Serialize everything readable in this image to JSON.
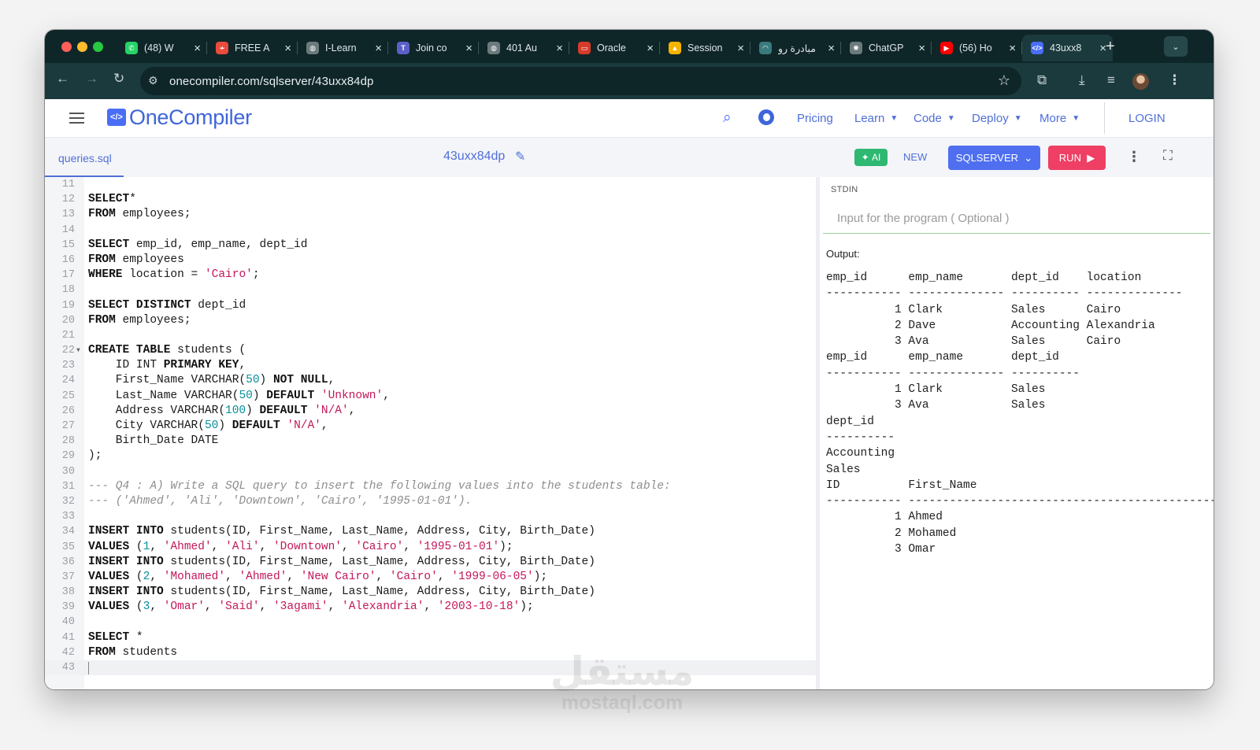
{
  "browser": {
    "tabs": [
      {
        "title": "(48) W",
        "icon": "whatsapp-icon",
        "color": "#25d366",
        "glyph": "✆"
      },
      {
        "title": "FREE A",
        "icon": "free-ai-icon",
        "color": "#e94b3c",
        "glyph": "≁"
      },
      {
        "title": "I-Learn",
        "icon": "globe-icon",
        "color": "#6b7b7d",
        "glyph": "◍"
      },
      {
        "title": "Join co",
        "icon": "teams-icon",
        "color": "#5b5fc7",
        "glyph": "T"
      },
      {
        "title": "401 Au",
        "icon": "globe-icon",
        "color": "#6b7b7d",
        "glyph": "◍"
      },
      {
        "title": "Oracle",
        "icon": "oracle-icon",
        "color": "#d63b2a",
        "glyph": "▭"
      },
      {
        "title": "Session",
        "icon": "google-drive-icon",
        "color": "#f4b400",
        "glyph": "▲"
      },
      {
        "title": "مبادرة رو",
        "icon": "initiative-icon",
        "color": "#3a7a7d",
        "glyph": "◠"
      },
      {
        "title": "ChatGP",
        "icon": "chatgpt-icon",
        "color": "#6b7b7d",
        "glyph": "✺"
      },
      {
        "title": "(56) Ho",
        "icon": "youtube-icon",
        "color": "#ff0000",
        "glyph": "▶"
      },
      {
        "title": "43uxx8",
        "icon": "onecompiler-icon",
        "color": "#4a6ef5",
        "glyph": "</>"
      }
    ],
    "url": "onecompiler.com/sqlserver/43uxx84dp"
  },
  "site": {
    "logo_mark": "</>",
    "logo_text": "OneCompiler",
    "nav": {
      "pricing": "Pricing",
      "learn": "Learn",
      "code": "Code",
      "deploy": "Deploy",
      "more": "More",
      "login": "LOGIN"
    }
  },
  "editor": {
    "file_tab": "queries.sql",
    "code_id": "43uxx84dp",
    "ai_label": "AI",
    "new_label": "NEW",
    "language": "SQLSERVER",
    "run_label": "RUN",
    "lines": [
      {
        "n": "11",
        "t": []
      },
      {
        "n": "12",
        "t": [
          [
            "kw",
            "SELECT"
          ],
          [
            "",
            "*"
          ]
        ]
      },
      {
        "n": "13",
        "t": [
          [
            "kw",
            "FROM"
          ],
          [
            "",
            " employees;"
          ]
        ]
      },
      {
        "n": "14",
        "t": []
      },
      {
        "n": "15",
        "t": [
          [
            "kw",
            "SELECT"
          ],
          [
            "",
            " emp_id, emp_name, dept_id"
          ]
        ]
      },
      {
        "n": "16",
        "t": [
          [
            "kw",
            "FROM"
          ],
          [
            "",
            " employees"
          ]
        ]
      },
      {
        "n": "17",
        "t": [
          [
            "kw",
            "WHERE"
          ],
          [
            "",
            " location = "
          ],
          [
            "str",
            "'Cairo'"
          ],
          [
            "",
            ";"
          ]
        ]
      },
      {
        "n": "18",
        "t": []
      },
      {
        "n": "19",
        "t": [
          [
            "kw",
            "SELECT DISTINCT"
          ],
          [
            "",
            " dept_id"
          ]
        ]
      },
      {
        "n": "20",
        "t": [
          [
            "kw",
            "FROM"
          ],
          [
            "",
            " employees;"
          ]
        ]
      },
      {
        "n": "21",
        "t": []
      },
      {
        "n": "22",
        "fold": true,
        "t": [
          [
            "kw",
            "CREATE TABLE"
          ],
          [
            "",
            " students ("
          ]
        ]
      },
      {
        "n": "23",
        "t": [
          [
            "",
            "    ID INT "
          ],
          [
            "kw",
            "PRIMARY KEY"
          ],
          [
            "",
            ","
          ]
        ]
      },
      {
        "n": "24",
        "t": [
          [
            "",
            "    First_Name VARCHAR("
          ],
          [
            "num",
            "50"
          ],
          [
            "",
            ") "
          ],
          [
            "kw",
            "NOT NULL"
          ],
          [
            "",
            ","
          ]
        ]
      },
      {
        "n": "25",
        "t": [
          [
            "",
            "    Last_Name VARCHAR("
          ],
          [
            "num",
            "50"
          ],
          [
            "",
            ") "
          ],
          [
            "kw",
            "DEFAULT"
          ],
          [
            "str",
            " 'Unknown'"
          ],
          [
            "",
            ","
          ]
        ]
      },
      {
        "n": "26",
        "t": [
          [
            "",
            "    Address VARCHAR("
          ],
          [
            "num",
            "100"
          ],
          [
            "",
            ") "
          ],
          [
            "kw",
            "DEFAULT"
          ],
          [
            "str",
            " 'N/A'"
          ],
          [
            "",
            ","
          ]
        ]
      },
      {
        "n": "27",
        "t": [
          [
            "",
            "    City VARCHAR("
          ],
          [
            "num",
            "50"
          ],
          [
            "",
            ") "
          ],
          [
            "kw",
            "DEFAULT"
          ],
          [
            "str",
            " 'N/A'"
          ],
          [
            "",
            ","
          ]
        ]
      },
      {
        "n": "28",
        "t": [
          [
            "",
            "    Birth_Date DATE"
          ]
        ]
      },
      {
        "n": "29",
        "t": [
          [
            "",
            ");"
          ]
        ]
      },
      {
        "n": "30",
        "t": []
      },
      {
        "n": "31",
        "t": [
          [
            "cmt",
            "--- Q4 : A) Write a SQL query to insert the following values into the students table:"
          ]
        ]
      },
      {
        "n": "32",
        "t": [
          [
            "cmt",
            "--- ('Ahmed', 'Ali', 'Downtown', 'Cairo', '1995-01-01')."
          ]
        ]
      },
      {
        "n": "33",
        "t": []
      },
      {
        "n": "34",
        "t": [
          [
            "kw",
            "INSERT INTO"
          ],
          [
            "",
            " students(ID, First_Name, Last_Name, Address, City, Birth_Date)"
          ]
        ]
      },
      {
        "n": "35",
        "t": [
          [
            "kw",
            "VALUES"
          ],
          [
            "",
            " ("
          ],
          [
            "num",
            "1"
          ],
          [
            "",
            ", "
          ],
          [
            "str",
            "'Ahmed'"
          ],
          [
            "",
            ", "
          ],
          [
            "str",
            "'Ali'"
          ],
          [
            "",
            ", "
          ],
          [
            "str",
            "'Downtown'"
          ],
          [
            "",
            ", "
          ],
          [
            "str",
            "'Cairo'"
          ],
          [
            "",
            ", "
          ],
          [
            "str",
            "'1995-01-01'"
          ],
          [
            "",
            ");"
          ]
        ]
      },
      {
        "n": "36",
        "t": [
          [
            "kw",
            "INSERT INTO"
          ],
          [
            "",
            " students(ID, First_Name, Last_Name, Address, City, Birth_Date)"
          ]
        ]
      },
      {
        "n": "37",
        "t": [
          [
            "kw",
            "VALUES"
          ],
          [
            "",
            " ("
          ],
          [
            "num",
            "2"
          ],
          [
            "",
            ", "
          ],
          [
            "str",
            "'Mohamed'"
          ],
          [
            "",
            ", "
          ],
          [
            "str",
            "'Ahmed'"
          ],
          [
            "",
            ", "
          ],
          [
            "str",
            "'New Cairo'"
          ],
          [
            "",
            ", "
          ],
          [
            "str",
            "'Cairo'"
          ],
          [
            "",
            ", "
          ],
          [
            "str",
            "'1999-06-05'"
          ],
          [
            "",
            ");"
          ]
        ]
      },
      {
        "n": "38",
        "t": [
          [
            "kw",
            "INSERT INTO"
          ],
          [
            "",
            " students(ID, First_Name, Last_Name, Address, City, Birth_Date)"
          ]
        ]
      },
      {
        "n": "39",
        "t": [
          [
            "kw",
            "VALUES"
          ],
          [
            "",
            " ("
          ],
          [
            "num",
            "3"
          ],
          [
            "",
            ", "
          ],
          [
            "str",
            "'Omar'"
          ],
          [
            "",
            ", "
          ],
          [
            "str",
            "'Said'"
          ],
          [
            "",
            ", "
          ],
          [
            "str",
            "'3agami'"
          ],
          [
            "",
            ", "
          ],
          [
            "str",
            "'Alexandria'"
          ],
          [
            "",
            ", "
          ],
          [
            "str",
            "'2003-10-18'"
          ],
          [
            "",
            ");"
          ]
        ]
      },
      {
        "n": "40",
        "t": []
      },
      {
        "n": "41",
        "t": [
          [
            "kw",
            "SELECT"
          ],
          [
            "",
            " *"
          ]
        ]
      },
      {
        "n": "42",
        "t": [
          [
            "kw",
            "FROM"
          ],
          [
            "",
            " students"
          ]
        ]
      },
      {
        "n": "43",
        "current": true,
        "t": []
      }
    ]
  },
  "io": {
    "stdin_label": "STDIN",
    "stdin_placeholder": "Input for the program ( Optional )",
    "output_label": "Output:",
    "output_text": "emp_id      emp_name       dept_id    location\n----------- -------------- ---------- --------------\n          1 Clark          Sales      Cairo\n          2 Dave           Accounting Alexandria\n          3 Ava            Sales      Cairo\nemp_id      emp_name       dept_id\n----------- -------------- ----------\n          1 Clark          Sales\n          3 Ava            Sales\ndept_id\n----------\nAccounting\nSales\nID          First_Name\n----------- --------------------------------------------------\n          1 Ahmed\n          2 Mohamed\n          3 Omar"
  },
  "watermark": {
    "arabic": "مستقل",
    "latin": "mostaql.com"
  }
}
